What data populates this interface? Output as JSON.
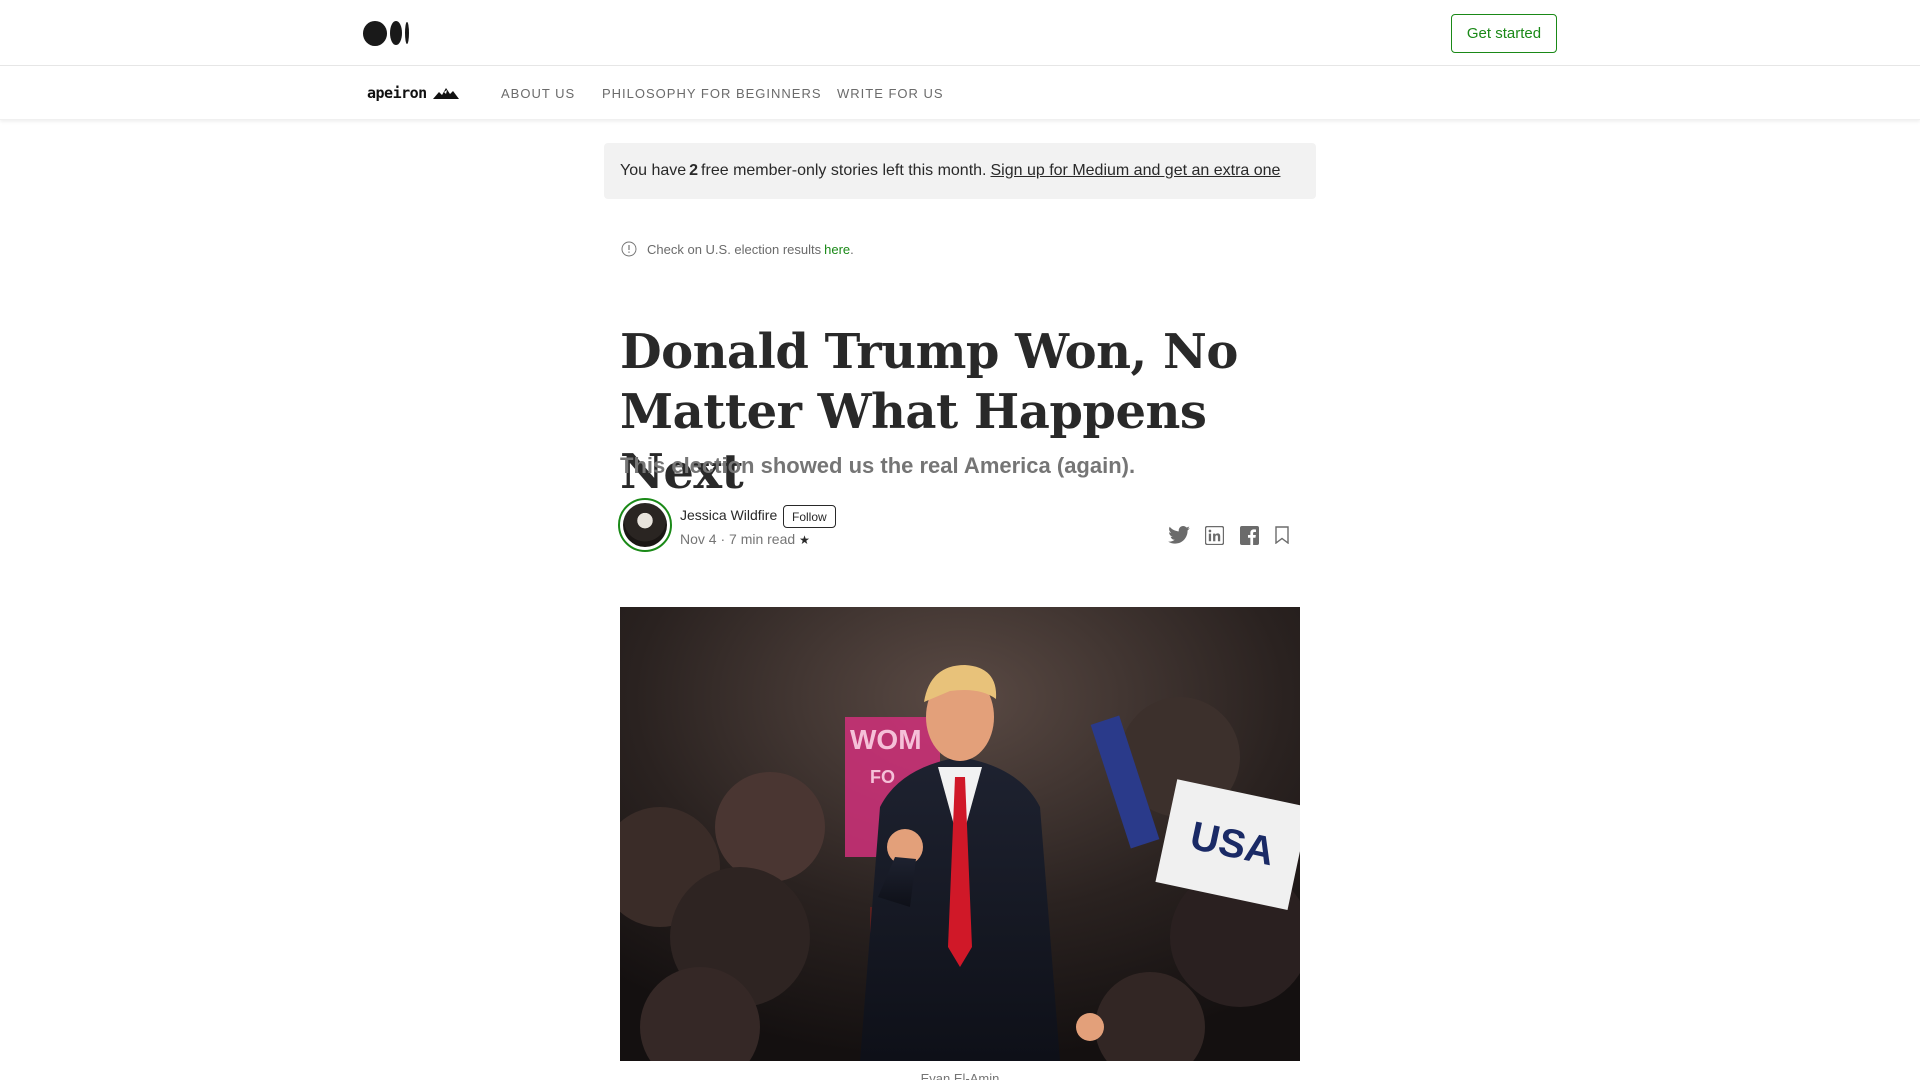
{
  "topbar": {
    "logo_name": "medium-logo",
    "get_started_label": "Get started",
    "accent": "#1a8917"
  },
  "publication": {
    "logo_text": "apeiron",
    "nav": [
      {
        "label": "ABOUT US"
      },
      {
        "label": "PHILOSOPHY FOR BEGINNERS"
      },
      {
        "label": "WRITE FOR US"
      }
    ]
  },
  "member_banner": {
    "prefix": "You have",
    "count": "2",
    "suffix": "free member-only stories left this month.",
    "link": "Sign up for Medium and get an extra one"
  },
  "election_notice": {
    "icon": "info-icon",
    "text": "Check on U.S. election results",
    "link": "here",
    "trail": "."
  },
  "article": {
    "title": "Donald Trump Won, No Matter What Happens Next",
    "subtitle": "This election showed us the real America (again).",
    "author": "Jessica Wildfire",
    "follow_label": "Follow",
    "meta": "Nov 4 · 7 min read",
    "member_star": "★",
    "share_icons": [
      "twitter-icon",
      "linkedin-icon",
      "facebook-icon",
      "bookmark-icon"
    ],
    "image_caption": "Evan El-Amin"
  }
}
